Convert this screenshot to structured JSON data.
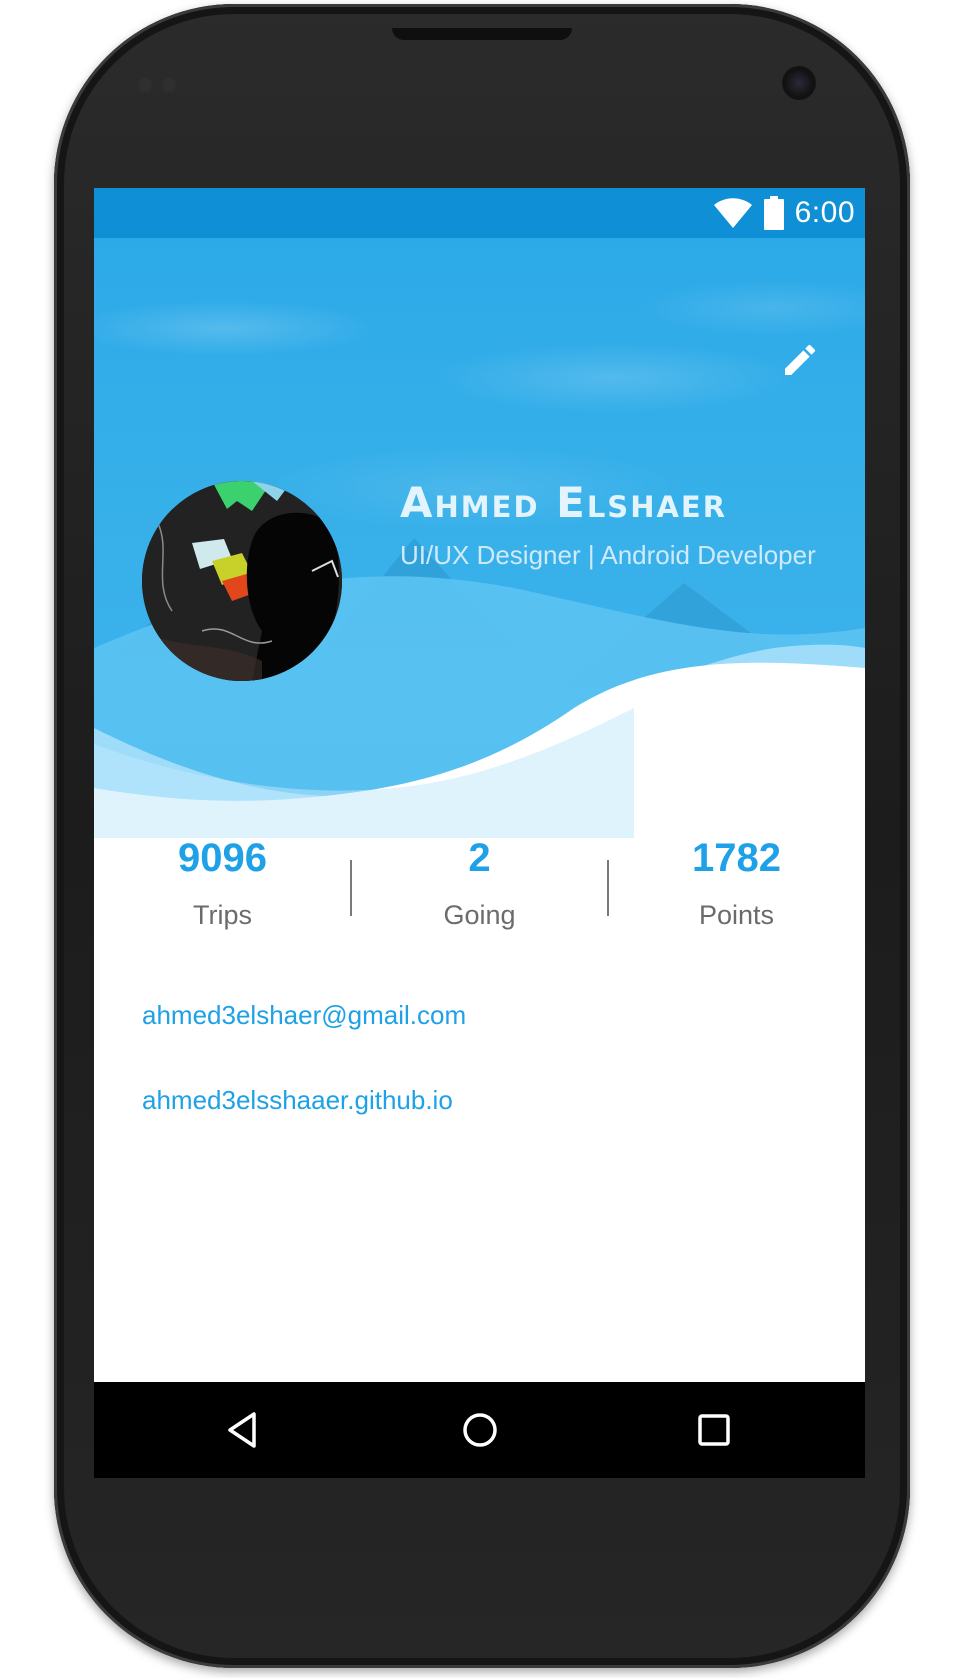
{
  "status_bar": {
    "time": "6:00",
    "wifi_icon": "wifi-icon",
    "battery_icon": "battery-icon"
  },
  "header": {
    "edit_icon": "pencil-icon",
    "profile": {
      "name": "Ahmed Elshaer",
      "role": "UI/UX Designer | Android Developer"
    }
  },
  "stats": [
    {
      "value": "9096",
      "label": "Trips"
    },
    {
      "value": "2",
      "label": "Going"
    },
    {
      "value": "1782",
      "label": "Points"
    }
  ],
  "contacts": {
    "email": "ahmed3elshaer@gmail.com",
    "website": "ahmed3elsshaaer.github.io"
  },
  "nav_bar": {
    "back_icon": "back-triangle-icon",
    "home_icon": "home-circle-icon",
    "recents_icon": "recents-square-icon"
  },
  "colors": {
    "header_blue": "#35afe9",
    "status_bar_blue": "#0e8fd6",
    "accent_blue": "#1ea1e6",
    "label_gray": "#6b6b6b"
  }
}
